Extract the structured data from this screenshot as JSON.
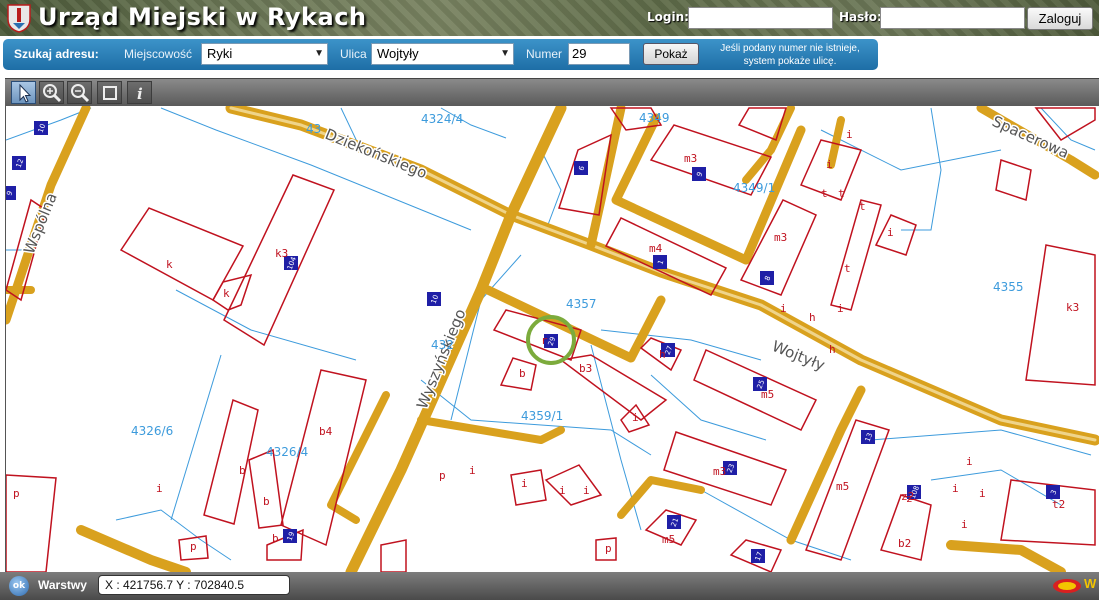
{
  "header": {
    "title": "Urząd Miejski w Rykach",
    "login_label": "Login:",
    "login_value": "",
    "password_label": "Hasło:",
    "password_value": "",
    "login_button": "Zaloguj"
  },
  "search": {
    "title": "Szukaj adresu:",
    "town_label": "Miejscowość",
    "town_value": "Ryki",
    "street_label": "Ulica",
    "street_value": "Wojtyły",
    "number_label": "Numer",
    "number_value": "29",
    "show_button": "Pokaż",
    "hint": "Jeśli podany numer nie istnieje, system pokaże ulicę."
  },
  "toolbar": {
    "tools": [
      "pointer-tool",
      "zoom-in-tool",
      "zoom-out-tool",
      "full-extent-tool",
      "info-tool"
    ]
  },
  "map": {
    "streets": [
      "Dziekońskiego",
      "Wyszyńskiego",
      "Wspólna",
      "Wojtyły",
      "Spacerowa"
    ],
    "parcels": [
      "4324/4",
      "4349/1",
      "4357",
      "4326/6",
      "4326/4",
      "4359/1",
      "4355",
      "4349",
      "432",
      "43"
    ],
    "building_labels": {
      "k": "k",
      "k3": "k3",
      "m3": "m3",
      "m4": "m4",
      "m5": "m5",
      "b": "b",
      "b3": "b3",
      "b4": "b4",
      "b2": "b2",
      "i": "i",
      "h": "h",
      "p": "p",
      "t": "t",
      "z": "z",
      "z2": "z2",
      "t2": "t2",
      "r": "r"
    },
    "house_numbers": [
      "10",
      "12",
      "9",
      "6",
      "104",
      "10",
      "29",
      "27",
      "9",
      "25",
      "13",
      "23",
      "21",
      "17",
      "19",
      "108",
      "3",
      "1",
      "8"
    ],
    "colors": {
      "street_fill": "#d9a11e",
      "building_outline": "#c0121f",
      "parcel_line": "#3d9bdc",
      "parcel_text": "#3d9bdc",
      "house_badge": "#1f1fa6",
      "highlight_ring": "#7cab3c"
    }
  },
  "footer": {
    "layers_label": "Warstwy",
    "coordinates": "X : 421756.7  Y : 702840.5",
    "ok_icon_text": "ok",
    "brand_text": "W"
  }
}
